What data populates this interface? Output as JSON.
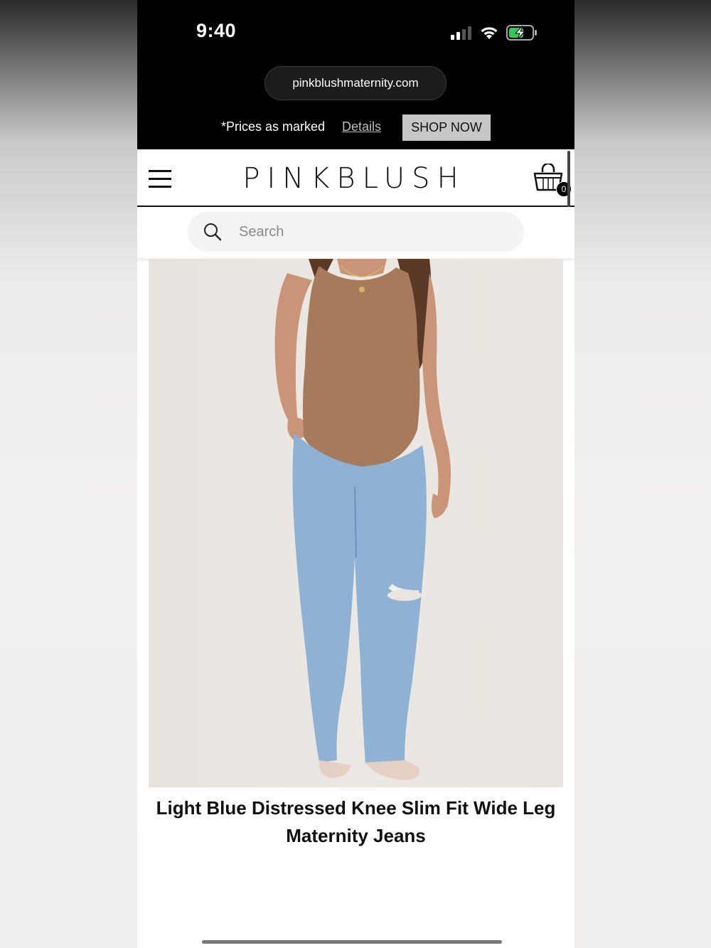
{
  "status_bar": {
    "time": "9:40"
  },
  "browser": {
    "url": "pinkblushmaternity.com"
  },
  "promo": {
    "text": "*Prices as marked",
    "details_label": "Details",
    "shop_label": "SHOP NOW"
  },
  "header": {
    "logo": "PINKBLUSH",
    "cart_count": "0"
  },
  "search": {
    "placeholder": "Search"
  },
  "product": {
    "title": "Light Blue Distressed Knee Slim Fit Wide Leg Maternity Jeans",
    "colors": {
      "top": "#a87a5c",
      "jeans": "#8fb1d3",
      "skin": "#c99477",
      "hair": "#5a3a26"
    }
  }
}
